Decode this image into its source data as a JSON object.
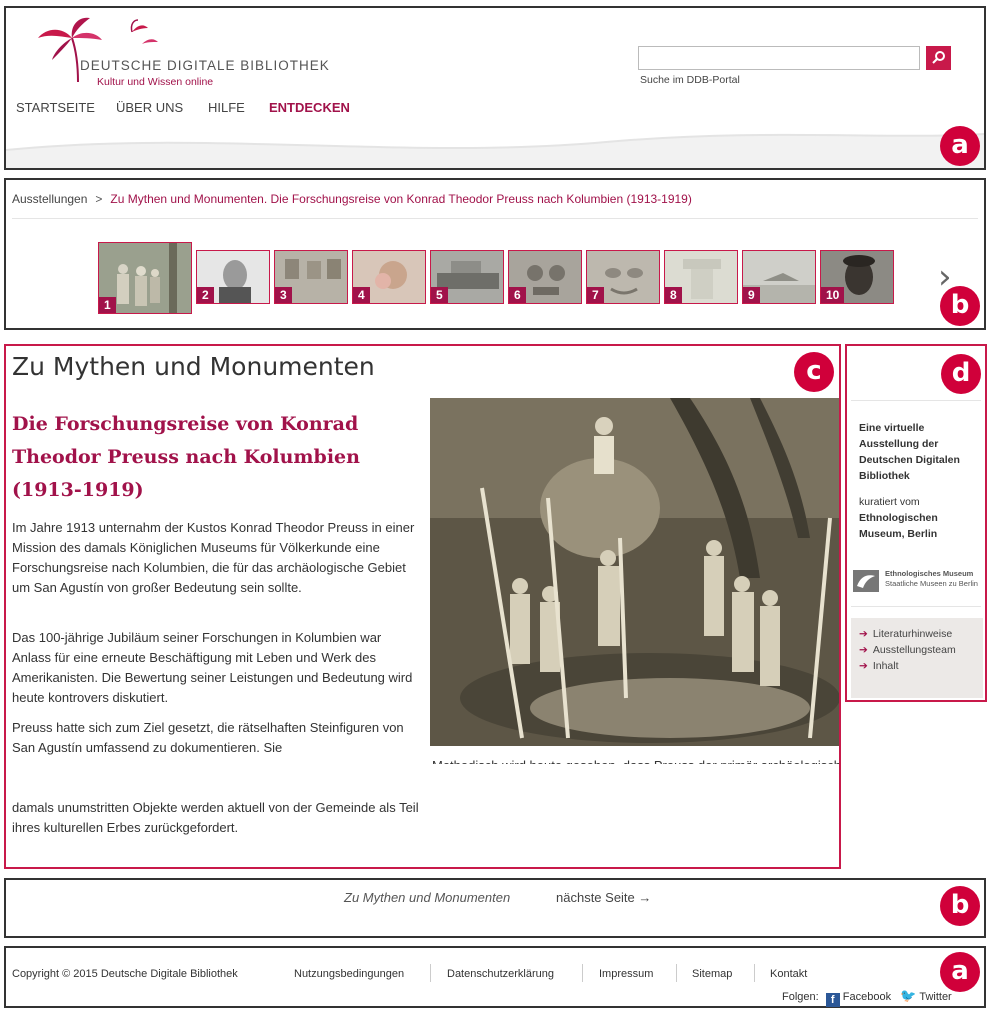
{
  "header": {
    "logo_title": "DEUTSCHE DIGITALE BIBLIOTHEK",
    "logo_subtitle": "Kultur und Wissen online",
    "nav": [
      "STARTSEITE",
      "ÜBER UNS",
      "HILFE",
      "ENTDECKEN"
    ],
    "active_nav": "ENTDECKEN",
    "search_value": "",
    "search_hint": "Suche im DDB-Portal",
    "search_icon": "search-icon"
  },
  "markers": {
    "header": "a",
    "navband": "b",
    "main": "c",
    "sidebar": "d",
    "pager": "b",
    "footer": "a"
  },
  "breadcrumb": {
    "home": "Ausstellungen",
    "separator": ">",
    "current": "Zu Mythen und Monumenten. Die Forschungsreise von Konrad Theodor Preuss nach Kolumbien (1913-1919)"
  },
  "thumbnails": [
    "1",
    "2",
    "3",
    "4",
    "5",
    "6",
    "7",
    "8",
    "9",
    "10"
  ],
  "thumbnail_next": "next-arrow-icon",
  "main": {
    "title": "Zu Mythen und Monumenten",
    "subtitle": "Die Forschungsreise von Konrad Theodor Preuss nach Kolumbien (1913-1919)",
    "p1": "Im Jahre 1913 unternahm der Kustos Konrad Theodor Preuss in einer Mission des damals Königlichen Museums für Völkerkunde eine Forschungsreise nach Kolumbien, die für das archäologische Gebiet um San Agustín von großer Bedeutung sein sollte.",
    "p2": "Das 100-jährige Jubiläum seiner Forschungen in Kolumbien war Anlass für eine erneute Beschäftigung mit Leben und Werk des Amerikanisten. Die Bewertung seiner Leistungen und Bedeutung wird heute kontrovers diskutiert.",
    "p3": "Preuss hatte sich zum Ziel gesetzt, die rätselhaften Steinfiguren von San Agustín umfassend zu dokumentieren. Sie",
    "p4": "damals unumstritten Objekte werden aktuell von der Gemeinde als Teil ihres kulturellen Erbes zurückgefordert.",
    "photo_caption": "Methodisch wird heute gesehen, dass Preuss der primär archäologischen"
  },
  "sidebar": {
    "title": "Eine virtuelle Ausstellung der Deutschen Digitalen Bibliothek",
    "curated_by": "kuratiert vom",
    "museum": "Ethnologischen Museum, Berlin",
    "logo_line1": "Ethnologisches Museum",
    "logo_line2": "Staatliche Museen zu Berlin",
    "links": [
      "Literaturhinweise",
      "Ausstellungsteam",
      "Inhalt"
    ]
  },
  "pager": {
    "title": "Zu Mythen und Monumenten",
    "next": "nächste Seite →"
  },
  "footer": {
    "copyright": "Copyright © 2015 Deutsche Digitale Bibliothek",
    "links": [
      "Nutzungsbedingungen",
      "Datenschutzerklärung",
      "Impressum",
      "Sitemap",
      "Kontakt"
    ],
    "follow": "Folgen:",
    "facebook": "Facebook",
    "twitter": "Twitter"
  },
  "colors": {
    "accent": "#a1124a",
    "marker": "#d0003a",
    "frame_pink": "#c8194a"
  }
}
